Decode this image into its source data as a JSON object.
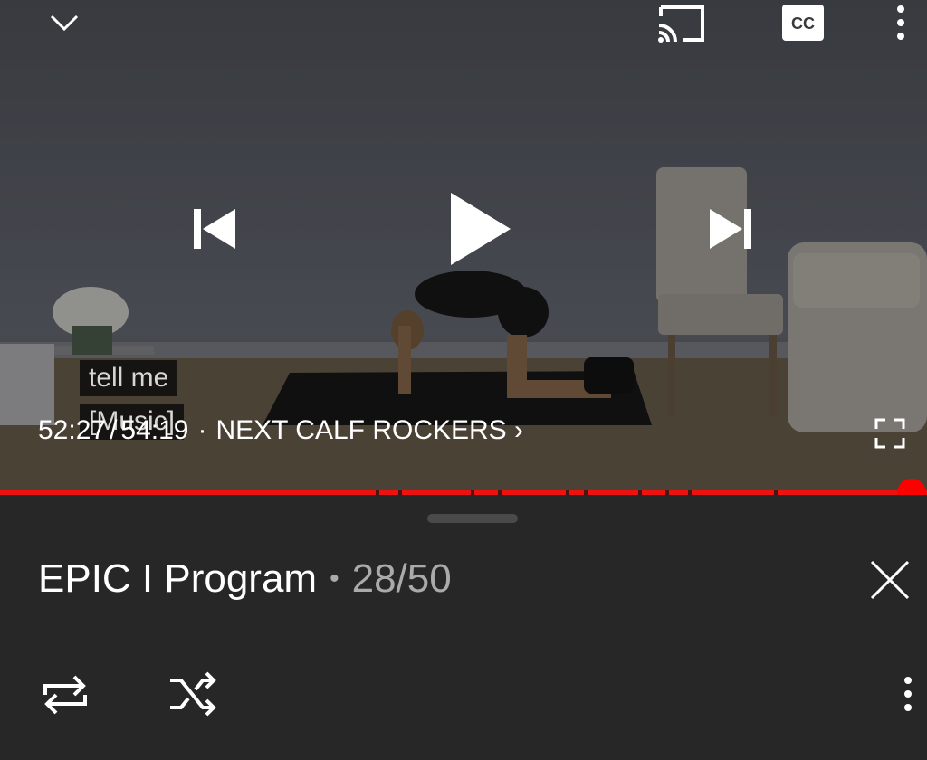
{
  "player": {
    "caption_line1": "tell me",
    "caption_line2": "[Music]",
    "current_time": "52:27",
    "time_separator": "/",
    "duration": "54:19",
    "next_separator": "·",
    "next_label": "NEXT CALF ROCKERS ›",
    "progress": 0.965,
    "accent_color": "#ff0000",
    "icons": [
      "chevron-down-icon",
      "cast-icon",
      "cc-icon",
      "more-vert-icon",
      "previous-icon",
      "play-icon",
      "next-icon",
      "fullscreen-icon"
    ]
  },
  "playlist": {
    "title": "EPIC I Program",
    "bullet": "•",
    "position": "28/50",
    "icons": [
      "close-icon",
      "repeat-icon",
      "shuffle-icon",
      "more-vert-icon"
    ]
  }
}
